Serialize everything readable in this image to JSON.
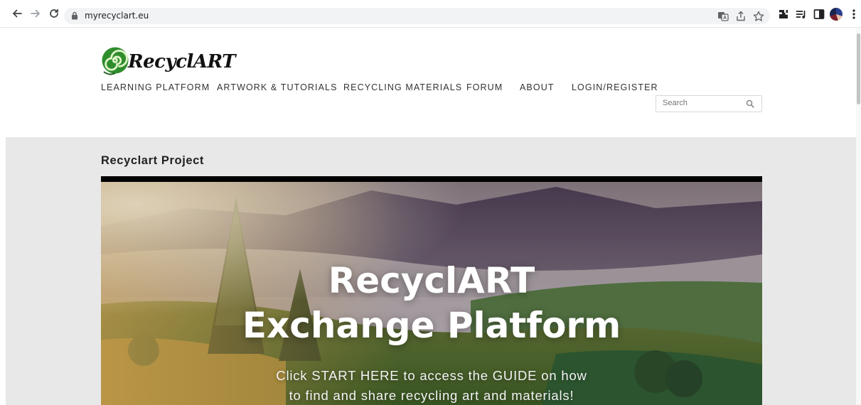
{
  "browser": {
    "url": "myrecyclart.eu",
    "icons": [
      "back-icon",
      "forward-icon",
      "reload-icon",
      "lock-icon",
      "translate-icon",
      "share-icon",
      "star-icon",
      "extensions-icon",
      "reading-list-icon",
      "side-panel-icon",
      "avatar",
      "kebab-menu-icon"
    ]
  },
  "site": {
    "logo_text": "RecyclART",
    "nav": {
      "learning": "LEARNING PLATFORM",
      "artwork": "ARTWORK & TUTORIALS",
      "materials": "RECYCLING MATERIALS",
      "forum": "FORUM",
      "about": "ABOUT",
      "login": "LOGIN/REGISTER"
    },
    "search": {
      "placeholder": "Search"
    }
  },
  "content": {
    "page_title": "Recyclart Project",
    "hero": {
      "title_line1": "RecyclART",
      "title_line2": "Exchange Platform",
      "sub_line1": "Click START HERE to access the GUIDE on how",
      "sub_line2": "to find and share recycling art and materials!"
    }
  },
  "colors": {
    "logo_green": "#2f8d2c",
    "content_bg": "#e8e8e8",
    "menu_text": "#333333"
  }
}
